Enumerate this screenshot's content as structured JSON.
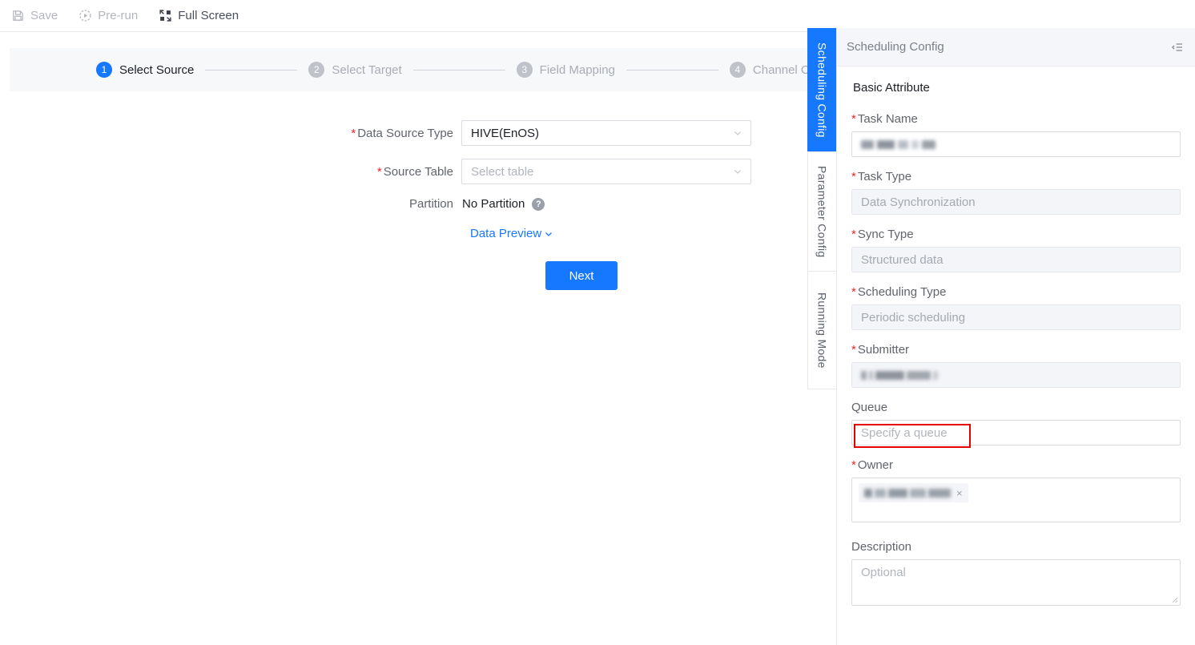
{
  "toolbar": {
    "save": {
      "label": "Save",
      "icon": "save-icon",
      "enabled": false
    },
    "prerun": {
      "label": "Pre-run",
      "icon": "play-circle-dashed-icon",
      "enabled": false
    },
    "fullscreen": {
      "label": "Full Screen",
      "icon": "fullscreen-icon",
      "enabled": true
    }
  },
  "steps": [
    {
      "num": "1",
      "label": "Select Source",
      "active": true
    },
    {
      "num": "2",
      "label": "Select Target",
      "active": false
    },
    {
      "num": "3",
      "label": "Field Mapping",
      "active": false
    },
    {
      "num": "4",
      "label": "Channel Con",
      "active": false
    }
  ],
  "main": {
    "data_source_type": {
      "label": "Data Source Type",
      "required": true,
      "value": "HIVE(EnOS)",
      "icon": "chevron-down-icon"
    },
    "source_table": {
      "label": "Source Table",
      "required": true,
      "value": "",
      "placeholder": "Select table",
      "icon": "chevron-down-icon"
    },
    "partition": {
      "label": "Partition",
      "required": false,
      "value": "No Partition",
      "help_icon": "question-circle-icon",
      "help_glyph": "?"
    },
    "data_preview": {
      "label": "Data Preview",
      "icon": "chevron-down-icon"
    },
    "next_button": {
      "label": "Next"
    }
  },
  "drawer": {
    "title": "Scheduling Config",
    "fold_icon": "menu-fold-icon",
    "section_title": "Basic Attribute",
    "fields": {
      "task_name": {
        "label": "Task Name",
        "required": true,
        "value": "",
        "redacted": true
      },
      "task_type": {
        "label": "Task Type",
        "required": true,
        "value": "Data Synchronization",
        "readonly": true
      },
      "sync_type": {
        "label": "Sync Type",
        "required": true,
        "value": "Structured data",
        "readonly": true
      },
      "scheduling_type": {
        "label": "Scheduling Type",
        "required": true,
        "value": "Periodic scheduling",
        "readonly": true
      },
      "submitter": {
        "label": "Submitter",
        "required": true,
        "value": "",
        "readonly": true,
        "redacted": true
      },
      "queue": {
        "label": "Queue",
        "required": false,
        "value": "",
        "placeholder": "Specify a queue",
        "highlighted": true
      },
      "owner": {
        "label": "Owner",
        "required": true,
        "tag_value": "",
        "tag_redacted": true,
        "tag_remove_icon": "close-icon",
        "tag_remove_glyph": "×"
      },
      "description": {
        "label": "Description",
        "required": false,
        "value": "",
        "placeholder": "Optional"
      }
    }
  },
  "rail_tabs": [
    {
      "label": "Scheduling Config",
      "active": true
    },
    {
      "label": "Parameter Config",
      "active": false
    },
    {
      "label": "Running Mode",
      "active": false
    }
  ],
  "colors": {
    "accent": "#1677ff",
    "required_star": "#f5222d",
    "annotation": "#e60000",
    "step_inactive": "#bfc2c9",
    "panel_header_bg": "#f5f6fa",
    "steps_bg": "#f7f8fa"
  }
}
